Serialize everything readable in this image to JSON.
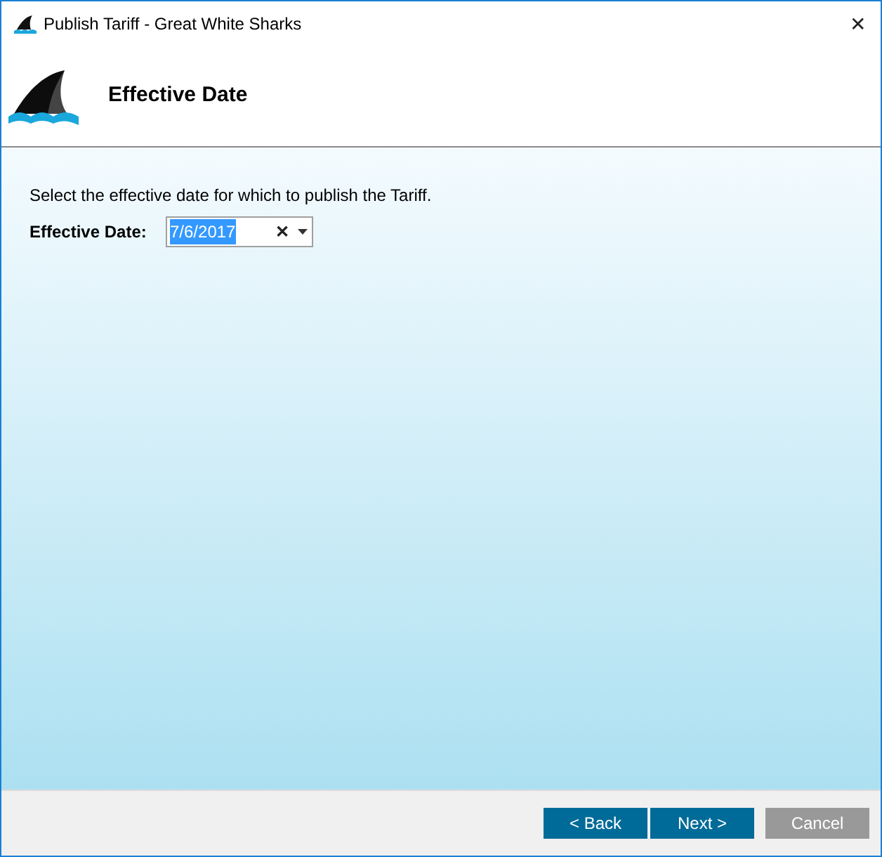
{
  "window": {
    "title": "Publish Tariff - Great White Sharks",
    "close": "✕"
  },
  "header": {
    "title": "Effective Date"
  },
  "body": {
    "instruction": "Select the effective date for which to publish the Tariff.",
    "date_label": "Effective Date:",
    "date_field": {
      "value": "7/6/2017",
      "text_selected": true,
      "clear": "✕"
    }
  },
  "buttons": [
    {
      "label": "< Back",
      "disabled": false
    },
    {
      "label": "Next >",
      "disabled": false
    },
    {
      "label": "Cancel",
      "disabled": true
    }
  ]
}
